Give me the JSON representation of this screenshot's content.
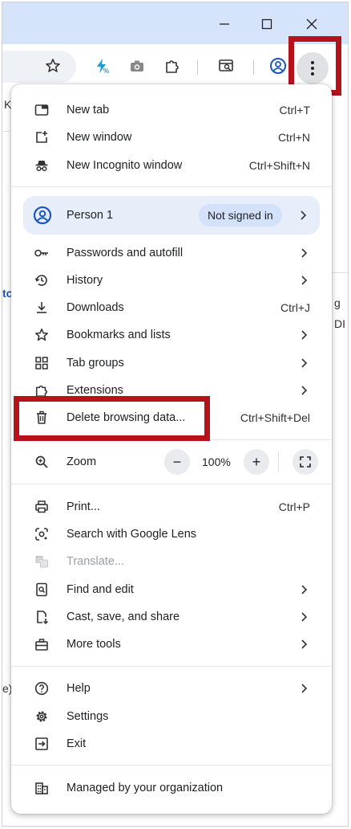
{
  "window": {
    "minimize_icon": "minimize-icon",
    "maximize_icon": "maximize-icon",
    "close_icon": "close-icon"
  },
  "background": {
    "left_text_1": "K",
    "left_text_2": "tc",
    "left_text_3": "e)",
    "right_text_1": "g",
    "right_text_2": "DI"
  },
  "menu": {
    "new_tab": {
      "label": "New tab",
      "shortcut": "Ctrl+T"
    },
    "new_window": {
      "label": "New window",
      "shortcut": "Ctrl+N"
    },
    "new_incognito": {
      "label": "New Incognito window",
      "shortcut": "Ctrl+Shift+N"
    },
    "profile": {
      "name": "Person 1",
      "status": "Not signed in"
    },
    "passwords": {
      "label": "Passwords and autofill"
    },
    "history": {
      "label": "History"
    },
    "downloads": {
      "label": "Downloads",
      "shortcut": "Ctrl+J"
    },
    "bookmarks": {
      "label": "Bookmarks and lists"
    },
    "tab_groups": {
      "label": "Tab groups"
    },
    "extensions": {
      "label": "Extensions"
    },
    "delete_browsing": {
      "label": "Delete browsing data...",
      "shortcut": "Ctrl+Shift+Del"
    },
    "zoom": {
      "label": "Zoom",
      "value": "100%",
      "minus": "−",
      "plus": "+"
    },
    "print": {
      "label": "Print...",
      "shortcut": "Ctrl+P"
    },
    "lens": {
      "label": "Search with Google Lens"
    },
    "translate": {
      "label": "Translate..."
    },
    "find_edit": {
      "label": "Find and edit"
    },
    "cast_save": {
      "label": "Cast, save, and share"
    },
    "more_tools": {
      "label": "More tools"
    },
    "help": {
      "label": "Help"
    },
    "settings": {
      "label": "Settings"
    },
    "exit": {
      "label": "Exit"
    },
    "managed": {
      "label": "Managed by your organization"
    }
  },
  "colors": {
    "highlight": "#b5121b",
    "titlebar": "#d6e4fb",
    "accent": "#1a73e8",
    "menu_bg": "#ffffff"
  }
}
